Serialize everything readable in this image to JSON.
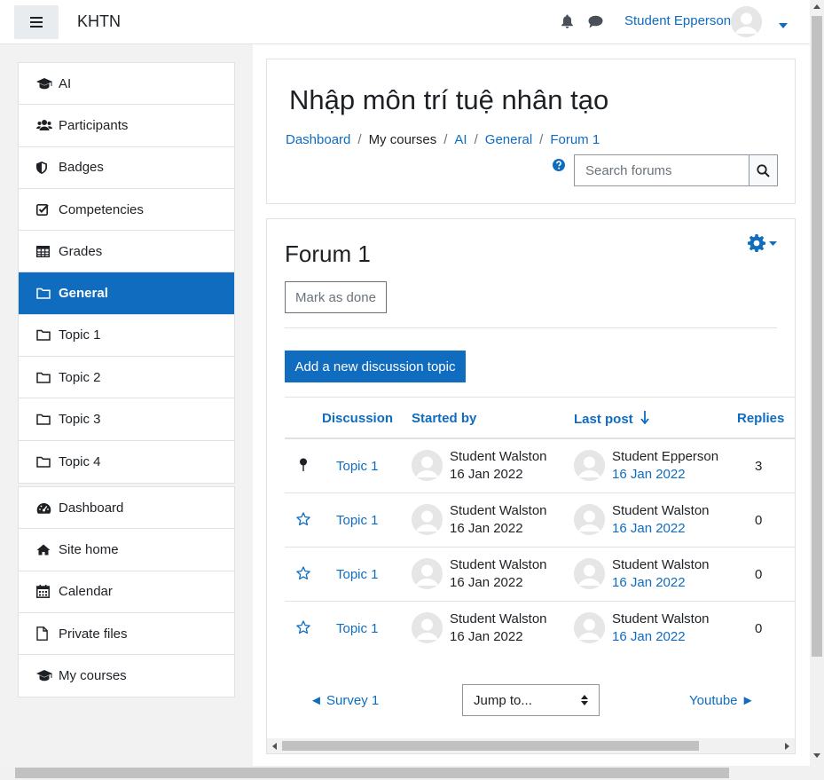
{
  "navbar": {
    "site_name": "KHTN",
    "user_name": "Student Epperson"
  },
  "sidebar": {
    "course_items": [
      {
        "label": "AI",
        "icon": "graduation-cap-icon",
        "active": false
      },
      {
        "label": "Participants",
        "icon": "users-icon",
        "active": false
      },
      {
        "label": "Badges",
        "icon": "shield-icon",
        "active": false
      },
      {
        "label": "Competencies",
        "icon": "check-square-icon",
        "active": false
      },
      {
        "label": "Grades",
        "icon": "table-icon",
        "active": false
      },
      {
        "label": "General",
        "icon": "folder-icon",
        "active": true
      },
      {
        "label": "Topic 1",
        "icon": "folder-icon",
        "active": false
      },
      {
        "label": "Topic 2",
        "icon": "folder-icon",
        "active": false
      },
      {
        "label": "Topic 3",
        "icon": "folder-icon",
        "active": false
      },
      {
        "label": "Topic 4",
        "icon": "folder-icon",
        "active": false
      }
    ],
    "site_items": [
      {
        "label": "Dashboard",
        "icon": "dashboard-icon"
      },
      {
        "label": "Site home",
        "icon": "home-icon"
      },
      {
        "label": "Calendar",
        "icon": "calendar-icon"
      },
      {
        "label": "Private files",
        "icon": "file-icon"
      },
      {
        "label": "My courses",
        "icon": "graduation-cap-icon"
      }
    ]
  },
  "header": {
    "title": "Nhập môn trí tuệ nhân tạo",
    "breadcrumb": [
      "Dashboard",
      "My courses",
      "AI",
      "General",
      "Forum 1"
    ],
    "search_placeholder": "Search forums"
  },
  "forum": {
    "title": "Forum 1",
    "mark_done_label": "Mark as done",
    "add_topic_label": "Add a new discussion topic",
    "columns": {
      "discussion": "Discussion",
      "started_by": "Started by",
      "last_post": "Last post",
      "replies": "Replies"
    },
    "rows": [
      {
        "pinned": true,
        "topic": "Topic 1",
        "starter": "Student Walston",
        "start_date": "16 Jan 2022",
        "last_user": "Student Epperson",
        "last_date": "16 Jan 2022",
        "replies": "3"
      },
      {
        "pinned": false,
        "topic": "Topic 1",
        "starter": "Student Walston",
        "start_date": "16 Jan 2022",
        "last_user": "Student Walston",
        "last_date": "16 Jan 2022",
        "replies": "0"
      },
      {
        "pinned": false,
        "topic": "Topic 1",
        "starter": "Student Walston",
        "start_date": "16 Jan 2022",
        "last_user": "Student Walston",
        "last_date": "16 Jan 2022",
        "replies": "0"
      },
      {
        "pinned": false,
        "topic": "Topic 1",
        "starter": "Student Walston",
        "start_date": "16 Jan 2022",
        "last_user": "Student Walston",
        "last_date": "16 Jan 2022",
        "replies": "0"
      }
    ],
    "prev_activity": "Survey 1",
    "next_activity": "Youtube",
    "jump_to": "Jump to..."
  },
  "colors": {
    "accent": "#0f6cbf",
    "text": "#1d2125",
    "border": "#dee2e6"
  }
}
